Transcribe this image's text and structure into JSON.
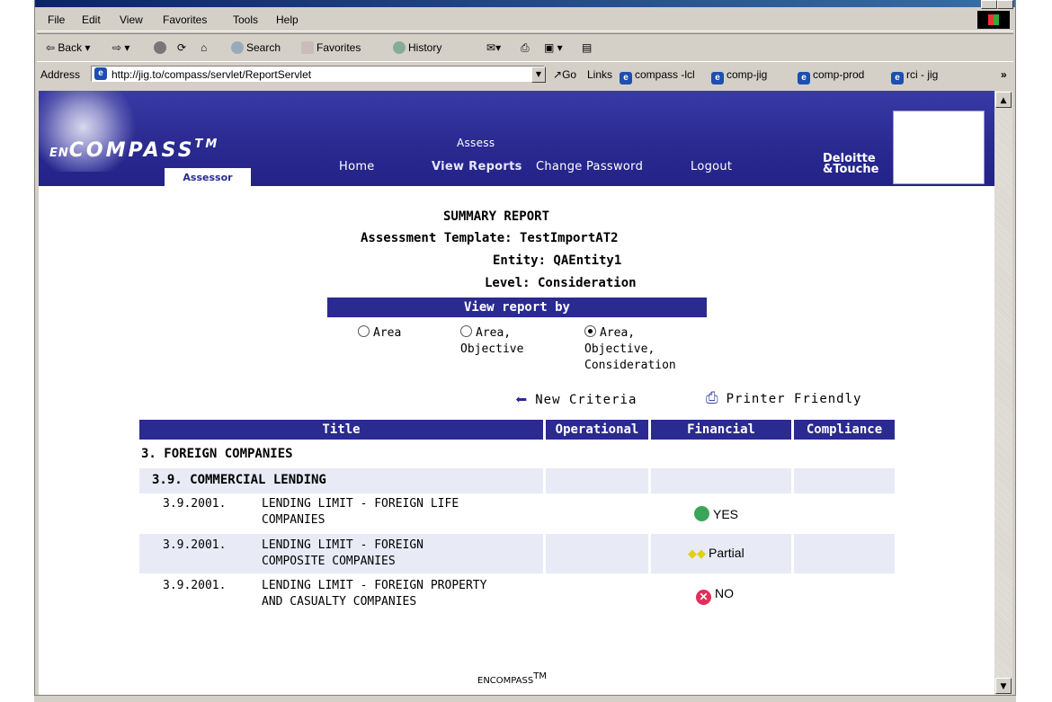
{
  "browser": {
    "menu": [
      "File",
      "Edit",
      "View",
      "Favorites",
      "Tools",
      "Help"
    ],
    "toolbar": {
      "back": "Back",
      "search": "Search",
      "favorites": "Favorites",
      "history": "History"
    },
    "address_label": "Address",
    "address_url": "http://jig.to/compass/servlet/ReportServlet",
    "go_label": "Go",
    "links_label": "Links",
    "links": [
      "compass -lcl",
      "comp-jig",
      "comp-prod",
      "rci - jig"
    ],
    "more": "»"
  },
  "site": {
    "logo_prefix": "EN",
    "logo_main": "COMPASS",
    "logo_tm": "TM",
    "role_badge": "Assessor",
    "nav": {
      "assess": "Assess",
      "home": "Home",
      "view_reports": "View Reports",
      "change_password": "Change Password",
      "logout": "Logout"
    },
    "brand_line1": "Deloitte",
    "brand_line2": "&Touche"
  },
  "report": {
    "heading": "SUMMARY REPORT",
    "template_line": "Assessment Template: TestImportAT2",
    "entity_line": "Entity: QAEntity1",
    "level_line": "Level: Consideration",
    "view_by_label": "View report by",
    "options": [
      {
        "label": "Area",
        "selected": false
      },
      {
        "label": "Area,\nObjective",
        "selected": false
      },
      {
        "label": "Area,\nObjective,\nConsideration",
        "selected": true
      }
    ],
    "new_criteria": "New Criteria",
    "printer_friendly": "Printer Friendly",
    "columns": [
      "Title",
      "Operational",
      "Financial",
      "Compliance"
    ],
    "area": "3. FOREIGN COMPANIES",
    "objective": "3.9.  COMMERCIAL LENDING",
    "rows": [
      {
        "code": "3.9.2001.",
        "title": "LENDING LIMIT - FOREIGN LIFE\nCOMPANIES",
        "financial": "YES",
        "financial_color": "#3aa55a"
      },
      {
        "code": "3.9.2001.",
        "title": "LENDING LIMIT - FOREIGN\nCOMPOSITE COMPANIES",
        "financial": "Partial",
        "financial_color": "#e8d820"
      },
      {
        "code": "3.9.2001.",
        "title": "LENDING LIMIT - FOREIGN PROPERTY\nAND CASUALTY COMPANIES",
        "financial": "NO",
        "financial_color": "#e0305a"
      }
    ]
  },
  "footer": {
    "text": "ENCOMPASS",
    "tm": "TM"
  }
}
